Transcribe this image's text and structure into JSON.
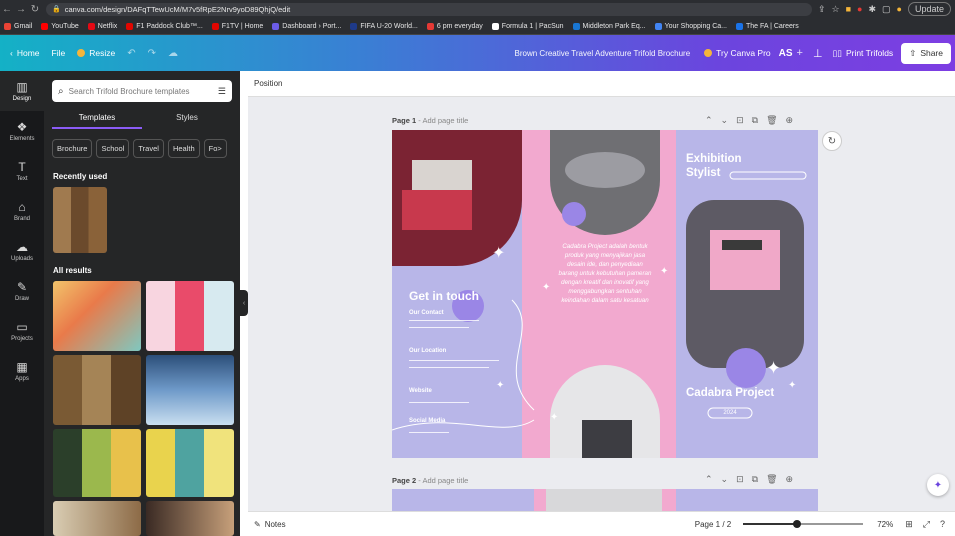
{
  "browser": {
    "url": "canva.com/design/DAFqTTewUcM/M7v5fRpE2Nrv9yoD89QhjQ/edit",
    "update_label": "Update",
    "bookmarks": [
      {
        "label": "Gmail",
        "color": "#ea4335"
      },
      {
        "label": "YouTube",
        "color": "#ff0000"
      },
      {
        "label": "Netflix",
        "color": "#e50914"
      },
      {
        "label": "F1 Paddock Club™...",
        "color": "#e10600"
      },
      {
        "label": "F1TV | Home",
        "color": "#e10600"
      },
      {
        "label": "Dashboard › Port...",
        "color": "#6c5ce7"
      },
      {
        "label": "FIFA U-20 World...",
        "color": "#1e3a8a"
      },
      {
        "label": "6 pm everyday",
        "color": "#e53935"
      },
      {
        "label": "Formula 1 | PacSun",
        "color": "#ffffff"
      },
      {
        "label": "Middleton Park Eq...",
        "color": "#1976d2"
      },
      {
        "label": "Your Shopping Ca...",
        "color": "#4285f4"
      },
      {
        "label": "The FA | Careers",
        "color": "#1a73e8"
      }
    ]
  },
  "header": {
    "home": "Home",
    "file": "File",
    "resize": "Resize",
    "title": "Brown Creative Travel Adventure Trifold Brochure",
    "try_pro": "Try Canva Pro",
    "avatar": "AS",
    "print": "Print Trifolds",
    "share": "Share"
  },
  "rail": [
    {
      "label": "Design",
      "icon": "layout-icon"
    },
    {
      "label": "Elements",
      "icon": "elements-icon"
    },
    {
      "label": "Text",
      "icon": "text-icon"
    },
    {
      "label": "Brand",
      "icon": "brand-icon"
    },
    {
      "label": "Uploads",
      "icon": "upload-icon"
    },
    {
      "label": "Draw",
      "icon": "draw-icon"
    },
    {
      "label": "Projects",
      "icon": "folder-icon"
    },
    {
      "label": "Apps",
      "icon": "apps-icon"
    }
  ],
  "panel": {
    "search_placeholder": "Search Trifold Brochure templates",
    "tab_templates": "Templates",
    "tab_styles": "Styles",
    "chips": [
      "Brochure",
      "School",
      "Travel",
      "Health",
      "Fo>"
    ],
    "recently_used": "Recently used",
    "all_results": "All results"
  },
  "toolbar": {
    "position": "Position"
  },
  "pages": {
    "page1_label": "Page 1",
    "page2_label": "Page 2",
    "add_title": "- Add page title"
  },
  "brochure": {
    "get_in_touch": "Get in touch",
    "our_contact": "Our Contact",
    "our_location": "Our Location",
    "website": "Website",
    "social_media": "Social Media",
    "body_text": "Cadabra Project adalah bentuk produk yang menyajikan jasa desain ide, dan penyediaan barang untuk kebutuhan pameran dengan kreatif dan inovatif yang menggabungkan sentuhan keindahan dalam satu kesatuan",
    "exhibition_stylist": "Exhibition Stylist",
    "project_name": "Cadabra Project",
    "year": "2024",
    "colors": {
      "pink": "#f2a9cf",
      "lavender": "#b8b6e8",
      "white": "#ffffff"
    }
  },
  "bottom": {
    "notes": "Notes",
    "page_count": "Page 1 / 2",
    "zoom": "72%",
    "zoom_fraction": 0.45
  }
}
